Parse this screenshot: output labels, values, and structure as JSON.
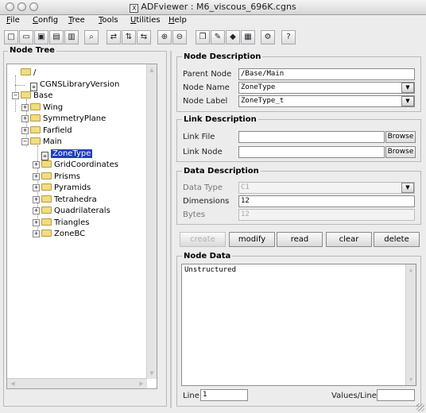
{
  "window": {
    "title": "ADFviewer : M6_viscous_696K.cgns"
  },
  "menu": [
    {
      "label": "File",
      "key": "F",
      "rest": "ile"
    },
    {
      "label": "Config",
      "key": "C",
      "rest": "onfig"
    },
    {
      "label": "Tree",
      "key": "T",
      "rest": "ree"
    },
    {
      "label": "Tools",
      "key": "T",
      "rest": "ools"
    },
    {
      "label": "Utilities",
      "key": "U",
      "rest": "tilities"
    },
    {
      "label": "Help",
      "key": "H",
      "rest": "elp"
    }
  ],
  "toolbar_icons": [
    "new-file-icon",
    "open-folder-icon",
    "save-icon",
    "save-as-icon",
    "print-icon",
    "find-icon",
    "link-icon",
    "unlink-icon",
    "compare-icon",
    "zoom-in-icon",
    "zoom-out-icon",
    "copy-icon",
    "edit-icon",
    "plot-icon",
    "table-icon",
    "settings-icon",
    "help-icon"
  ],
  "node_tree": {
    "title": "Node Tree",
    "items": [
      {
        "label": "/",
        "type": "folder",
        "expander": "",
        "level": 0
      },
      {
        "label": "CGNSLibraryVersion",
        "type": "doc",
        "expander": "",
        "level": 1
      },
      {
        "label": "Base",
        "type": "folder",
        "expander": "-",
        "level": 0
      },
      {
        "label": "Wing",
        "type": "folder",
        "expander": "+",
        "level": 1
      },
      {
        "label": "SymmetryPlane",
        "type": "folder",
        "expander": "+",
        "level": 1
      },
      {
        "label": "Farfield",
        "type": "folder",
        "expander": "+",
        "level": 1
      },
      {
        "label": "Main",
        "type": "folder",
        "expander": "-",
        "level": 1
      },
      {
        "label": "ZoneType",
        "type": "doc",
        "expander": "",
        "level": 2,
        "selected": true
      },
      {
        "label": "GridCoordinates",
        "type": "folder",
        "expander": "+",
        "level": 2
      },
      {
        "label": "Prisms",
        "type": "folder",
        "expander": "+",
        "level": 2
      },
      {
        "label": "Pyramids",
        "type": "folder",
        "expander": "+",
        "level": 2
      },
      {
        "label": "Tetrahedra",
        "type": "folder",
        "expander": "+",
        "level": 2
      },
      {
        "label": "Quadrilaterals",
        "type": "folder",
        "expander": "+",
        "level": 2
      },
      {
        "label": "Triangles",
        "type": "folder",
        "expander": "+",
        "level": 2
      },
      {
        "label": "ZoneBC",
        "type": "folder",
        "expander": "+",
        "level": 2
      }
    ]
  },
  "node_description": {
    "title": "Node Description",
    "parent_node_label": "Parent Node",
    "parent_node_value": "/Base/Main",
    "node_name_label": "Node Name",
    "node_name_value": "ZoneType",
    "node_label_label": "Node Label",
    "node_label_value": "ZoneType_t"
  },
  "link_description": {
    "title": "Link Description",
    "link_file_label": "Link File",
    "link_file_value": "",
    "link_node_label": "Link Node",
    "link_node_value": "",
    "browse_label": "Browse"
  },
  "data_description": {
    "title": "Data Description",
    "data_type_label": "Data Type",
    "data_type_value": "C1",
    "dimensions_label": "Dimensions",
    "dimensions_value": "12",
    "bytes_label": "Bytes",
    "bytes_value": "12"
  },
  "actions": {
    "create": "create",
    "modify": "modify",
    "read": "read",
    "clear": "clear",
    "delete": "delete"
  },
  "node_data": {
    "title": "Node Data",
    "content": "Unstructured",
    "line_label": "Line",
    "line_value": "1",
    "values_per_line_label": "Values/Line",
    "values_per_line_value": ""
  }
}
